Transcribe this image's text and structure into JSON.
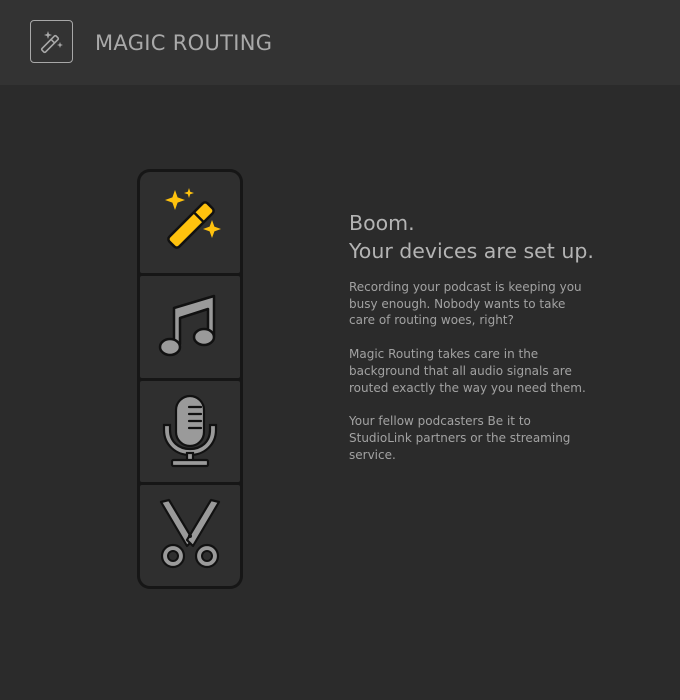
{
  "header": {
    "icon": "magic-wand-icon",
    "title": "MAGIC ROUTING"
  },
  "toolbar": {
    "items": [
      {
        "id": "magic",
        "icon": "magic-wand-icon",
        "active": true,
        "color": "#ffc20e"
      },
      {
        "id": "music",
        "icon": "music-note-icon",
        "active": false,
        "color": "#9a9a9a"
      },
      {
        "id": "microphone",
        "icon": "microphone-icon",
        "active": false,
        "color": "#9a9a9a"
      },
      {
        "id": "cut",
        "icon": "scissors-icon",
        "active": false,
        "color": "#9a9a9a"
      }
    ]
  },
  "content": {
    "headline_line1": "Boom.",
    "headline_line2": "Your devices are set up.",
    "paragraph1": "Recording your podcast is keeping you busy enough. Nobody wants to take care of routing woes, right?",
    "paragraph2": "Magic Routing takes care in the background that all audio signals are routed exactly the way you need them.",
    "paragraph3": "Your fellow podcasters Be it to StudioLink partners or the streaming service."
  },
  "colors": {
    "background": "#2b2b2b",
    "header_background": "#333333",
    "accent": "#ffc20e",
    "icon_gray": "#9a9a9a",
    "text": "#a2a2a2"
  }
}
